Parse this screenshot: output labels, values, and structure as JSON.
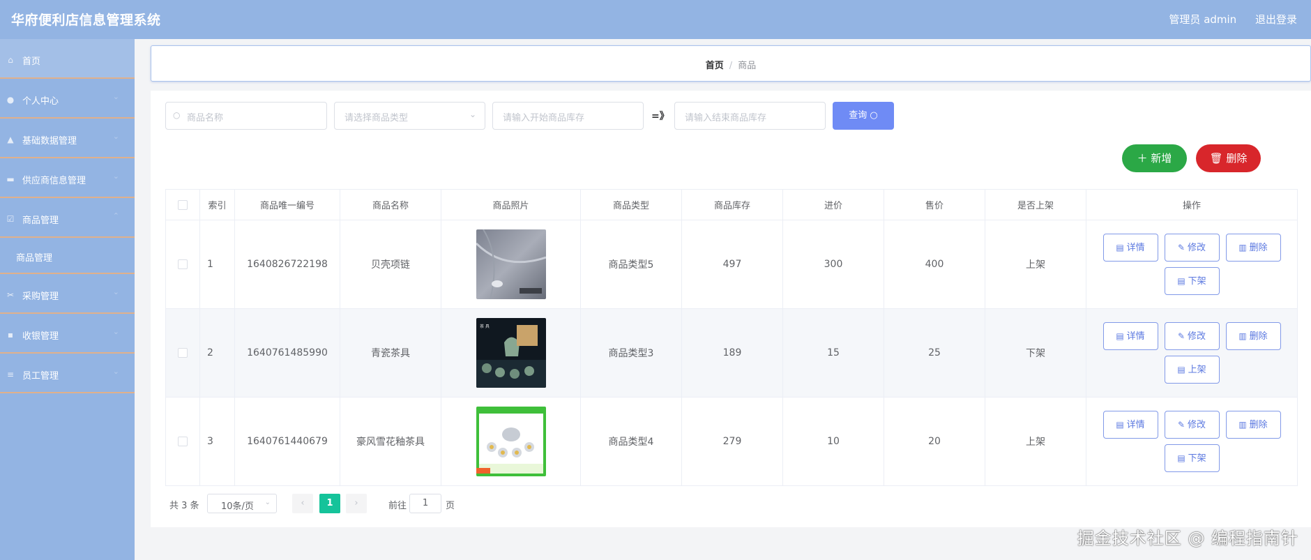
{
  "header": {
    "app_title": "华府便利店信息管理系统",
    "user_label": "管理员 admin",
    "logout_label": "退出登录"
  },
  "sidebar": {
    "items": [
      {
        "label": "首页",
        "icon": "home-icon"
      },
      {
        "label": "个人中心",
        "icon": "user-icon"
      },
      {
        "label": "基础数据管理",
        "icon": "person-icon"
      },
      {
        "label": "供应商信息管理",
        "icon": "monitor-icon"
      },
      {
        "label": "商品管理",
        "icon": "check-square-icon"
      },
      {
        "label": "商品管理",
        "icon": ""
      },
      {
        "label": "采购管理",
        "icon": "ticket-icon"
      },
      {
        "label": "收银管理",
        "icon": "chat-icon"
      },
      {
        "label": "员工管理",
        "icon": "sliders-icon"
      }
    ]
  },
  "breadcrumb": {
    "home": "首页",
    "sep": "/",
    "current": "商品"
  },
  "search": {
    "name_placeholder": "商品名称",
    "type_placeholder": "请选择商品类型",
    "stock_start_placeholder": "请输入开始商品库存",
    "range_sep": "=》",
    "stock_end_placeholder": "请输入结束商品库存",
    "query_label": "查询"
  },
  "actions": {
    "add_label": "新增",
    "delete_label": "删除"
  },
  "table": {
    "headers": [
      "索引",
      "商品唯一编号",
      "商品名称",
      "商品照片",
      "商品类型",
      "商品库存",
      "进价",
      "售价",
      "是否上架",
      "操作"
    ],
    "rows": [
      {
        "index": "1",
        "code": "1640826722198",
        "name": "贝壳项链",
        "type": "商品类型5",
        "stock": "497",
        "buy_price": "300",
        "sell_price": "400",
        "status": "上架",
        "toggle_label": "下架"
      },
      {
        "index": "2",
        "code": "1640761485990",
        "name": "青瓷茶具",
        "type": "商品类型3",
        "stock": "189",
        "buy_price": "15",
        "sell_price": "25",
        "status": "下架",
        "toggle_label": "上架"
      },
      {
        "index": "3",
        "code": "1640761440679",
        "name": "豪风雪花釉茶具",
        "type": "商品类型4",
        "stock": "279",
        "buy_price": "10",
        "sell_price": "20",
        "status": "上架",
        "toggle_label": "下架"
      }
    ],
    "op_labels": {
      "detail": "详情",
      "edit": "修改",
      "delete": "删除"
    }
  },
  "pagination": {
    "total": "共 3 条",
    "page_size": "10条/页",
    "current_page": "1",
    "goto_label": "前往",
    "goto_value": "1",
    "page_unit": "页"
  },
  "watermark": "掘金技术社区 @ 编程指南针",
  "colors": {
    "header": "#93b4e3",
    "query": "#6f8bf5",
    "add": "#2ba846",
    "delete": "#d8262b",
    "page_active": "#15c39a"
  }
}
